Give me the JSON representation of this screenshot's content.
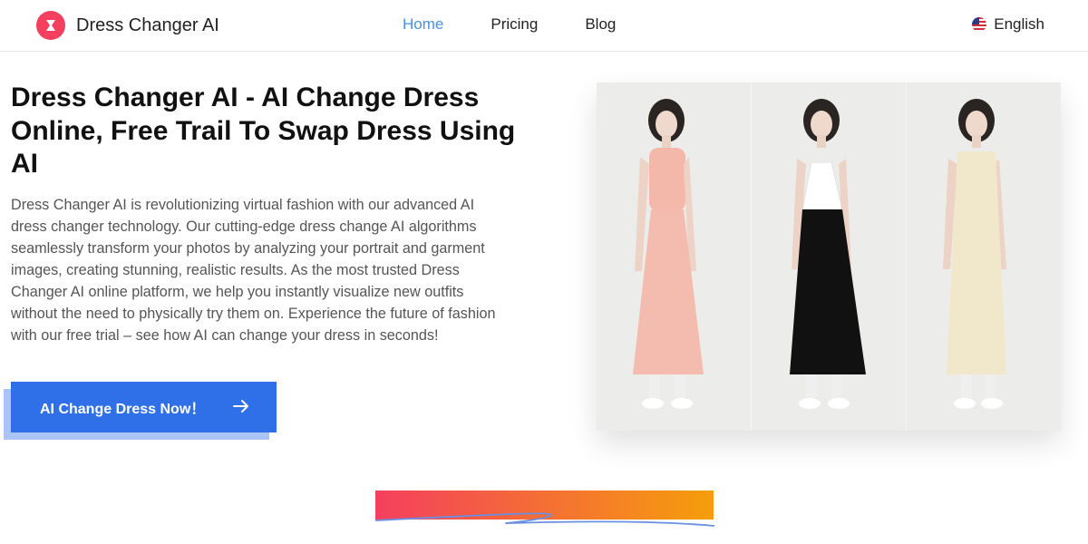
{
  "header": {
    "brand": "Dress Changer AI",
    "nav": [
      {
        "label": "Home",
        "active": true
      },
      {
        "label": "Pricing",
        "active": false
      },
      {
        "label": "Blog",
        "active": false
      }
    ],
    "language": "English"
  },
  "hero": {
    "title": "Dress Changer AI - AI Change Dress Online, Free Trail To Swap Dress Using AI",
    "description": "Dress Changer AI is revolutionizing virtual fashion with our advanced AI dress changer technology. Our cutting-edge dress change AI algorithms seamlessly transform your photos by analyzing your portrait and garment images, creating stunning, realistic results. As the most trusted Dress Changer AI online platform, we help you instantly visualize new outfits without the need to physically try them on. Experience the future of fashion with our free trial – see how AI can change your dress in seconds!",
    "cta_label": "AI Change Dress Now！"
  },
  "colors": {
    "accent": "#2f6fe8",
    "nav_active": "#4a90e2",
    "brand": "#f43f5e",
    "gradient_start": "#f43f5e",
    "gradient_end": "#f59e0b"
  },
  "icons": {
    "logo": "brand-logo-icon",
    "flag": "us-flag-icon",
    "cta": "arrow-right-icon"
  }
}
